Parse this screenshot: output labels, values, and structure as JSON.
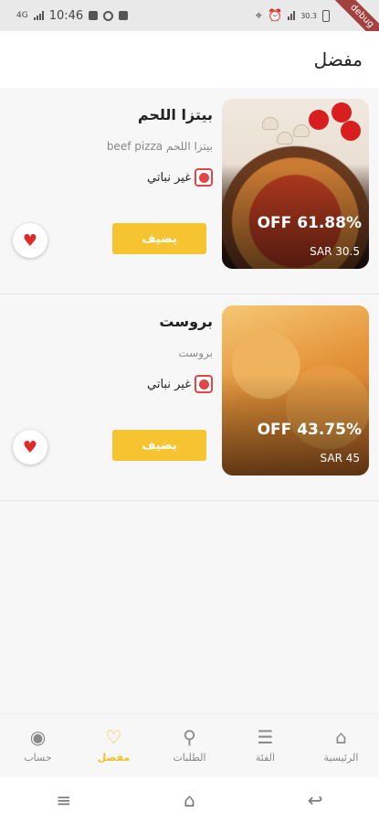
{
  "status_bar": {
    "time": "10:46",
    "network": "4G",
    "battery": "30.3"
  },
  "debug_banner": "debug",
  "app_bar": {
    "title": "مفضل"
  },
  "favorites": [
    {
      "name": "بيتزا اللحم",
      "description": "beef pizza بيتزا اللحم",
      "veg_label": "غير نباتي",
      "discount": "OFF 61.88%",
      "price": "SAR 30.5",
      "add_label": "يضيف",
      "image_icon": "pizza-image"
    },
    {
      "name": "بروست",
      "description": "بروست",
      "veg_label": "غير نباتي",
      "discount": "OFF 43.75%",
      "price": "SAR 45",
      "add_label": "يضيف",
      "image_icon": "chicken-image"
    }
  ],
  "bottom_nav": {
    "items": [
      {
        "label": "الرئيسية",
        "icon": "home-icon"
      },
      {
        "label": "الفئة",
        "icon": "category-icon"
      },
      {
        "label": "الطلبات",
        "icon": "orders-icon"
      },
      {
        "label": "مفضل",
        "icon": "heart-icon",
        "active": true
      },
      {
        "label": "حساب",
        "icon": "account-icon"
      }
    ]
  },
  "colors": {
    "accent": "#f6c431",
    "fav": "#e02b2b",
    "veg": "#e04646"
  }
}
